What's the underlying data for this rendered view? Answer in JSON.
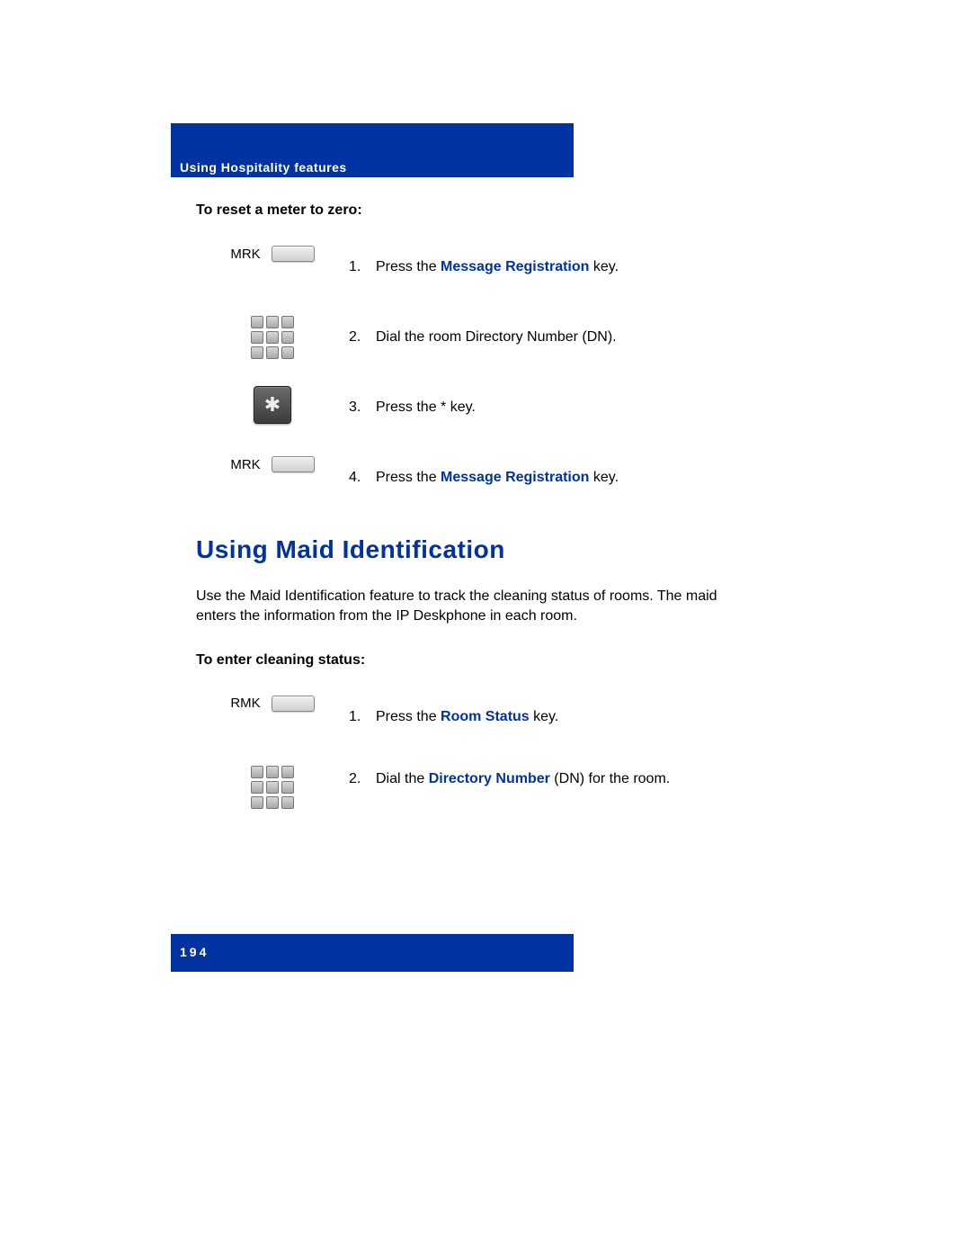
{
  "header": "Using Hospitality features",
  "section1": {
    "title": "To reset a meter to zero:",
    "steps": [
      {
        "iconLabel": "MRK",
        "num": "1.",
        "pre": "Press the ",
        "bold": "Message Registration",
        "post": " key."
      },
      {
        "iconLabel": "",
        "num": "2.",
        "pre": "Dial the room Directory Number (DN).",
        "bold": "",
        "post": ""
      },
      {
        "iconLabel": "",
        "num": "3.",
        "pre": "Press the * key.",
        "bold": "",
        "post": ""
      },
      {
        "iconLabel": "MRK",
        "num": "4.",
        "pre": "Press the ",
        "bold": "Message Registration",
        "post": " key."
      }
    ]
  },
  "heading2": "Using Maid Identification",
  "body2": "Use the Maid Identification feature to track the cleaning status of rooms. The maid enters the information from the IP Deskphone in each room.",
  "section2": {
    "title": "To enter cleaning status:",
    "steps": [
      {
        "iconLabel": "RMK",
        "num": "1.",
        "pre": "Press the ",
        "bold": "Room Status",
        "post": " key."
      },
      {
        "iconLabel": "",
        "num": "2.",
        "pre": "Dial the ",
        "bold": "Directory Number",
        "post": " (DN) for the room."
      }
    ]
  },
  "pageNumber": "194"
}
